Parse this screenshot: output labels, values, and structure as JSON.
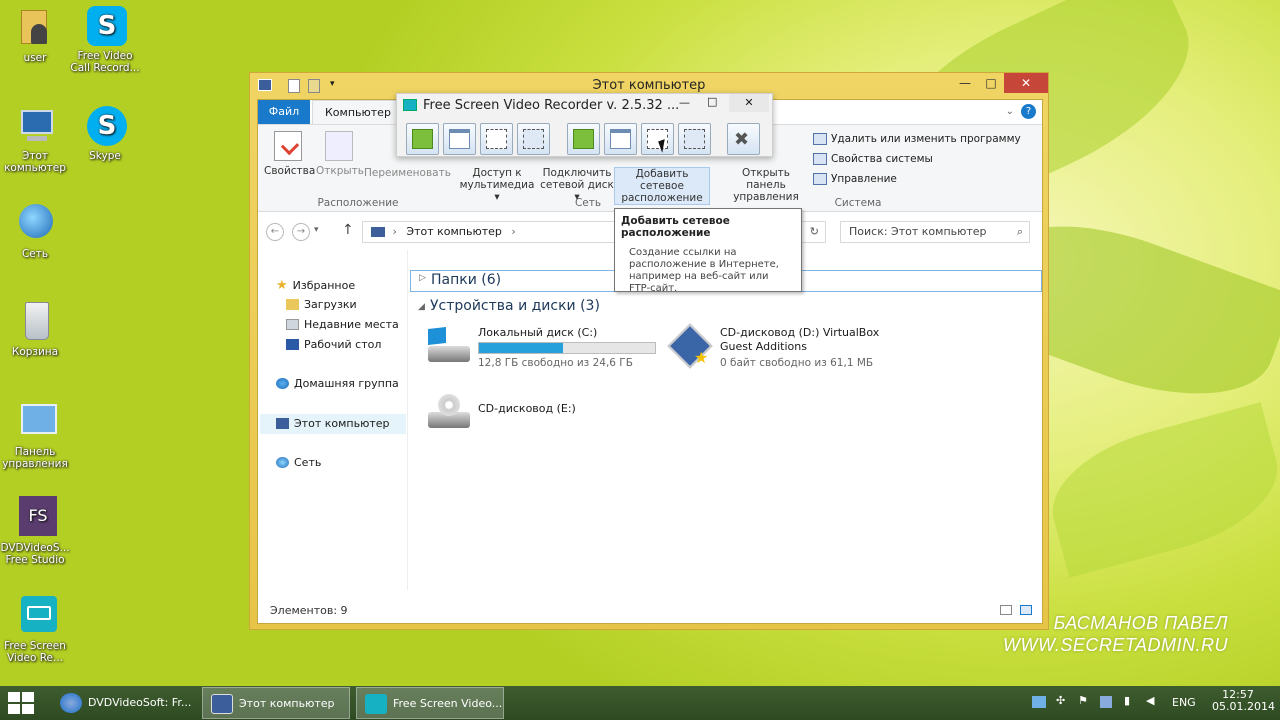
{
  "desktop": {
    "icons": [
      {
        "label": "user"
      },
      {
        "label": "Free Video Call Record..."
      },
      {
        "label": "Этот компьютер"
      },
      {
        "label": "Skype"
      },
      {
        "label": "Сеть"
      },
      {
        "label": "Корзина"
      },
      {
        "label": "Панель управления"
      },
      {
        "label": "DVDVideoS... Free Studio"
      },
      {
        "label": "Free Screen Video Re..."
      }
    ],
    "watermark": {
      "line1": "БАСМАНОВ ПАВЕЛ",
      "line2": "WWW.SECRETADMIN.RU"
    }
  },
  "explorer": {
    "title": "Этот компьютер",
    "tabs": {
      "file": "Файл",
      "computer": "Компьютер"
    },
    "ribbon": {
      "properties": "Свойства",
      "open": "Открыть",
      "rename": "Переименовать",
      "media_access": "Доступ к мультимедиа ▾",
      "map_drive": "Подключить сетевой диск ▾",
      "add_network": "Добавить сетевое расположение",
      "control_panel": "Открыть панель управления",
      "uninstall": "Удалить или изменить программу",
      "system_props": "Свойства системы",
      "manage": "Управление",
      "group_location": "Расположение",
      "group_network": "Сеть",
      "group_system": "Система"
    },
    "address": "Этот компьютер",
    "search_placeholder": "Поиск: Этот компьютер",
    "sidebar": {
      "favorites": "Избранное",
      "downloads": "Загрузки",
      "recent": "Недавние места",
      "desktop": "Рабочий стол",
      "homegroup": "Домашняя группа",
      "this_pc": "Этот компьютер",
      "network": "Сеть"
    },
    "groups": {
      "folders": "Папки (6)",
      "devices": "Устройства и диски (3)"
    },
    "drives": [
      {
        "name": "Локальный диск (C:)",
        "free": "12,8 ГБ свободно из 24,6 ГБ",
        "used_fraction": 0.48
      },
      {
        "name": "CD-дисковод (D:) VirtualBox Guest Additions",
        "free": "0 байт свободно из 61,1 МБ"
      },
      {
        "name": "CD-дисковод (E:)"
      }
    ],
    "status": "Элементов: 9"
  },
  "recorder": {
    "title": "Free Screen Video Recorder  v. 2.5.32 ..."
  },
  "tooltip": {
    "title": "Добавить сетевое расположение",
    "body": "Создание ссылки на расположение в Интернете, например на веб-сайт или FTP-сайт."
  },
  "taskbar": {
    "items": [
      "DVDVideoSoft: Fr...",
      "Этот компьютер",
      "Free Screen Video..."
    ],
    "lang": "ENG",
    "time": "12:57",
    "date": "05.01.2014"
  },
  "colors": {
    "accent": "#1979ca",
    "window_frame": "#e6c447",
    "taskbar": "#2e4a22"
  }
}
